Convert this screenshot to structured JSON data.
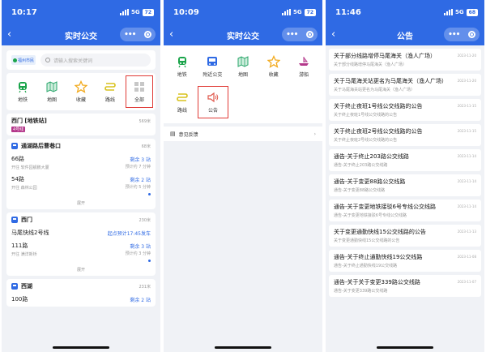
{
  "panel1": {
    "time": "10:17",
    "network": "5G",
    "battery": "72",
    "title": "实时公交",
    "search_placeholder": "请输入搜索关键词",
    "logo_text": "福州市民",
    "quick": [
      {
        "label": "地铁",
        "icon": "metro-icon"
      },
      {
        "label": "地图",
        "icon": "map-icon"
      },
      {
        "label": "收藏",
        "icon": "star-icon"
      },
      {
        "label": "路线",
        "icon": "route-icon"
      },
      {
        "label": "全部",
        "icon": "grid-icon"
      }
    ],
    "station1": {
      "name": "西门 [地铁站]",
      "tag": "4号线",
      "dist": "569米"
    },
    "stop1": {
      "name": "通湖路后曹巷口",
      "dist": "68米",
      "lines": [
        {
          "name": "66路",
          "sub": "开往 软件园舰鹏大厦",
          "remain": "剩余 3 站",
          "eta": "预计约 7 分钟"
        },
        {
          "name": "54路",
          "sub": "开往 森林公园",
          "remain": "剩余 2 站",
          "eta": "预计约 5 分钟"
        }
      ],
      "expand": "展开"
    },
    "stop2": {
      "name": "西门",
      "dist": "230米",
      "lines": [
        {
          "name": "马尾快线2号线",
          "sub": "",
          "remain": "起点预计17:45发车",
          "eta": ""
        },
        {
          "name": "111路",
          "sub": "开往 满洋新桥",
          "remain": "剩余 3 站",
          "eta": "预计约 3 分钟"
        }
      ],
      "expand": "展开"
    },
    "stop3": {
      "name": "西湖",
      "dist": "231米",
      "first_line": "100路",
      "remain": "剩余 2 站"
    }
  },
  "panel2": {
    "time": "10:09",
    "network": "5G",
    "battery": "72",
    "title": "实时公交",
    "row1": [
      {
        "label": "地铁",
        "icon": "metro-icon"
      },
      {
        "label": "附近公交",
        "icon": "bus-icon"
      },
      {
        "label": "地图",
        "icon": "map-icon"
      },
      {
        "label": "收藏",
        "icon": "star-icon"
      },
      {
        "label": "游船",
        "icon": "boat-icon"
      }
    ],
    "row2": [
      {
        "label": "路线",
        "icon": "route-icon"
      },
      {
        "label": "公告",
        "icon": "speaker-icon"
      }
    ],
    "feedback": "意见反馈"
  },
  "panel3": {
    "time": "11:46",
    "network": "5G",
    "battery": "68",
    "title": "公告",
    "items": [
      {
        "title": "关于部分线路增停马尾海关（渔人广场）",
        "sub": "关于部分线路增停马尾海关（渔人广场）",
        "date": "2023-11-20"
      },
      {
        "title": "关于马尾海关站更名为马尾海关（渔人广场）",
        "sub": "关于马尾海关站更名为马尾海关（渔人广场）",
        "date": "2023-11-20"
      },
      {
        "title": "关于终止夜班1号线公交线路的公告",
        "sub": "关于终止夜班1号线公交线路的公告",
        "date": "2023-11-15"
      },
      {
        "title": "关于终止夜班2号线公交线路的公告",
        "sub": "关于终止夜班2号线公交线路的公告",
        "date": "2023-11-15"
      },
      {
        "title": "通告-关于终止203路公交线路",
        "sub": "通告-关于终止203路公交线路",
        "date": "2023-11-14"
      },
      {
        "title": "通告-关于变更88路公交线路",
        "sub": "通告-关于变更88路公交线路",
        "date": "2023-11-14"
      },
      {
        "title": "通告-关于变更地铁接驳6号专线公交线路",
        "sub": "通告-关于变更地铁接驳6号专线公交线路",
        "date": "2023-11-14"
      },
      {
        "title": "关于变更通勤快线15公交线路的公告",
        "sub": "关于变更通勤快线15公交线路的公告",
        "date": "2023-11-13"
      },
      {
        "title": "通告-关于终止通勤快线19公交线路",
        "sub": "通告-关于终止通勤快线19公交线路",
        "date": "2023-11-08"
      },
      {
        "title": "通告-关于关于变更339路公交线路",
        "sub": "通告-关于变更339路公交线路",
        "date": "2023-11-07"
      }
    ]
  },
  "colors": {
    "brand": "#2f6ae4",
    "highlight": "#e03a36",
    "metro_tag": "#b4388b"
  }
}
